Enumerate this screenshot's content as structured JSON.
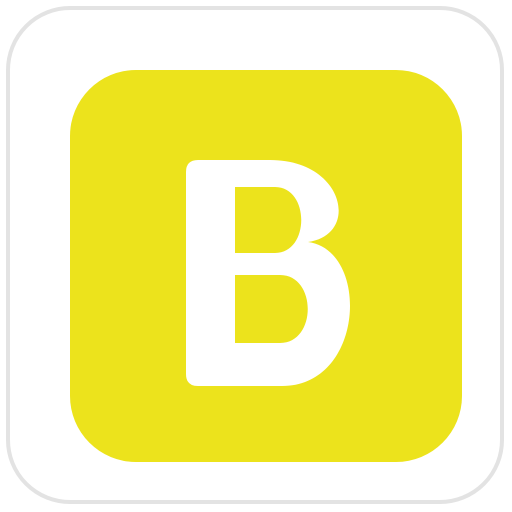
{
  "app_icon": {
    "letter": "B",
    "background_color": "#ffffff",
    "border_color": "#e3e3e3",
    "tile_color": "#ece31c",
    "letter_color": "#ffffff"
  }
}
